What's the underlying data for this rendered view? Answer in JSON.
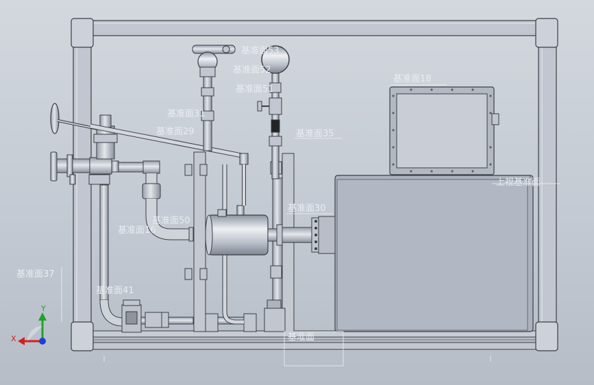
{
  "view": {
    "background_top": "#d3d8de",
    "background_bottom": "#b6bdc7",
    "frame_color": "#c2c6d0",
    "frame_stroke": "#3a3d44",
    "pipe_color": "#c9cdd6",
    "label_color": "#e9edf2"
  },
  "planes": [
    {
      "id": "plane-53",
      "text": "基准面53"
    },
    {
      "id": "plane-52",
      "text": "基准面52"
    },
    {
      "id": "plane-51",
      "text": "基准面51"
    },
    {
      "id": "plane-18",
      "text": "基准面18"
    },
    {
      "id": "plane-31",
      "text": "基准面31"
    },
    {
      "id": "plane-29",
      "text": "基准面29"
    },
    {
      "id": "plane-35",
      "text": "基准面35"
    },
    {
      "id": "plane-30",
      "text": "基准面30"
    },
    {
      "id": "plane-50",
      "text": "基准面50"
    },
    {
      "id": "plane-16",
      "text": "基准面16"
    },
    {
      "id": "plane-37",
      "text": "基准面37"
    },
    {
      "id": "plane-41",
      "text": "基准面41"
    },
    {
      "id": "plane-horizontal",
      "text": "上视基准面"
    },
    {
      "id": "plane-bottom",
      "text": "基准面"
    }
  ],
  "triad": {
    "x_label": "X",
    "y_label": "Y",
    "x_color": "#d21f1f",
    "y_color": "#1fa22a",
    "z_color": "#1f3fd2"
  }
}
